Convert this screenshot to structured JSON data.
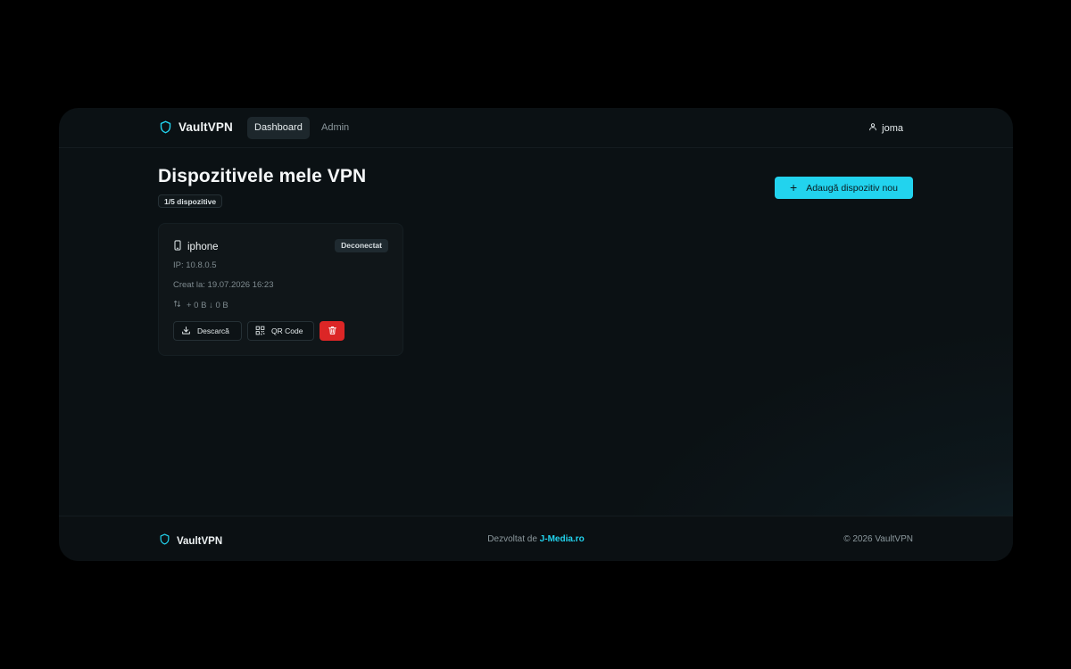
{
  "header": {
    "brand": "VaultVPN",
    "nav": [
      {
        "label": "Dashboard",
        "active": true
      },
      {
        "label": "Admin",
        "active": false
      }
    ],
    "user": {
      "name": "joma",
      "icon": "user-icon"
    }
  },
  "main": {
    "title": "Dispozitivele mele VPN",
    "device_count": "1/5 dispozitive",
    "add_button": {
      "label": "Adaugă dispozitiv nou",
      "icon": "plus-icon"
    },
    "devices": [
      {
        "name": "iphone",
        "icon": "phone-icon",
        "status": "Deconectat",
        "ip": "IP: 10.8.0.5",
        "created": "Creat la: 19.07.2026 16:23",
        "traffic": "+ 0 B  ↓ 0 B",
        "actions": {
          "download_label": "Descarcă",
          "qr_label": "QR Code"
        }
      }
    ]
  },
  "footer": {
    "brand": "VaultVPN",
    "credit_prefix": "Dezvoltat de",
    "credit_link": "J-Media.ro",
    "copyright": "© 2026 VaultVPN"
  },
  "colors": {
    "accent": "#22d3ee",
    "danger": "#dc2626",
    "background": "#0b1114",
    "card": "#101619"
  }
}
